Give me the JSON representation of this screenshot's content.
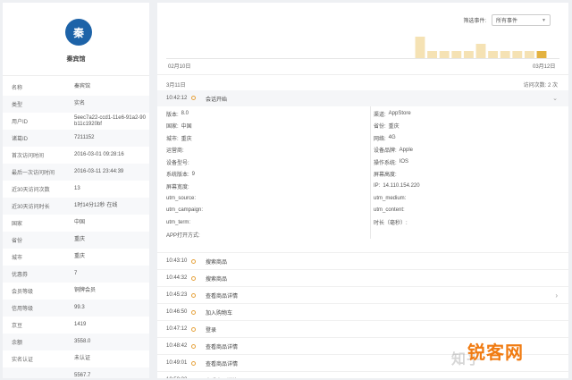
{
  "profile": {
    "avatar_char": "秦",
    "name": "秦宾馆"
  },
  "attributes": [
    {
      "key": "名称",
      "value": "秦宾馆"
    },
    {
      "key": "类型",
      "value": "实名"
    },
    {
      "key": "用户ID",
      "value": "5eec7a22-ccd1-11e6-91a2-90b11c1920bf"
    },
    {
      "key": "诸葛ID",
      "value": "7211152"
    },
    {
      "key": "首次访问时间",
      "value": "2016-03-01 09:28:16"
    },
    {
      "key": "最后一次访问时间",
      "value": "2016-03-11 23:44:39"
    },
    {
      "key": "近30天访问次数",
      "value": "13"
    },
    {
      "key": "近30天访问时长",
      "value": "1时14分12秒 在线"
    },
    {
      "key": "国家",
      "value": "中国"
    },
    {
      "key": "省份",
      "value": "重庆"
    },
    {
      "key": "城市",
      "value": "重庆"
    },
    {
      "key": "优惠券",
      "value": "7"
    },
    {
      "key": "会员等级",
      "value": "铜牌会员"
    },
    {
      "key": "信用等级",
      "value": "99.3"
    },
    {
      "key": "京豆",
      "value": "1419"
    },
    {
      "key": "余额",
      "value": "3558.0"
    },
    {
      "key": "实名认证",
      "value": "未认证"
    },
    {
      "key": "",
      "value": "5567.7"
    }
  ],
  "filter": {
    "label": "筛选事件:",
    "value": "所有事件"
  },
  "chart_data": {
    "type": "bar",
    "x_start": "02月10日",
    "x_end": "03月12日",
    "values": [
      0,
      0,
      0,
      0,
      0,
      0,
      0,
      0,
      0,
      0,
      0,
      0,
      0,
      0,
      0,
      0,
      0,
      0,
      0,
      0,
      3,
      1,
      1,
      1,
      1,
      2,
      1,
      1,
      1,
      1,
      1
    ],
    "highlight_index": 30,
    "colors": {
      "bar": "#f5e2b4",
      "highlight": "#e3b240"
    }
  },
  "session": {
    "date": "3月11日",
    "visits_label": "访问次数: 2 次",
    "start_time": "10:42:12",
    "start_label": "会话开始",
    "props_left": [
      {
        "key": "版本:",
        "value": "8.0"
      },
      {
        "key": "国家:",
        "value": "中国"
      },
      {
        "key": "城市:",
        "value": "重庆"
      },
      {
        "key": "运营商:",
        "value": ""
      },
      {
        "key": "设备型号:",
        "value": ""
      },
      {
        "key": "系统版本:",
        "value": "9"
      },
      {
        "key": "屏幕宽度:",
        "value": ""
      },
      {
        "key": "utm_source:",
        "value": ""
      },
      {
        "key": "utm_campaign:",
        "value": ""
      },
      {
        "key": "utm_term:",
        "value": ""
      },
      {
        "key": "APP打开方式:",
        "value": ""
      }
    ],
    "props_right": [
      {
        "key": "渠道:",
        "value": "AppStore"
      },
      {
        "key": "省份:",
        "value": "重庆"
      },
      {
        "key": "网络:",
        "value": "4G"
      },
      {
        "key": "设备品牌:",
        "value": "Apple"
      },
      {
        "key": "操作系统:",
        "value": "IOS"
      },
      {
        "key": "屏幕高度:",
        "value": ""
      },
      {
        "key": "IP:",
        "value": "14.110.154.220"
      },
      {
        "key": "utm_medium:",
        "value": ""
      },
      {
        "key": "utm_content:",
        "value": ""
      },
      {
        "key": "时长（毫秒）:",
        "value": ""
      }
    ]
  },
  "events": [
    {
      "time": "10:43:10",
      "label": "搜索商品"
    },
    {
      "time": "10:44:32",
      "label": "搜索商品"
    },
    {
      "time": "10:45:23",
      "label": "查看商品详情"
    },
    {
      "time": "10:46:50",
      "label": "加入购物车"
    },
    {
      "time": "10:47:12",
      "label": "登录"
    },
    {
      "time": "10:48:42",
      "label": "查看商品详情"
    },
    {
      "time": "10:49:01",
      "label": "查看商品详情"
    },
    {
      "time": "10:50:32",
      "label": "查看商品详情"
    }
  ],
  "watermark": {
    "ghost": "知乎",
    "brand": "锐客网"
  },
  "icons": {
    "dot": "event-dot-icon",
    "chevron": "chevron-icon"
  }
}
